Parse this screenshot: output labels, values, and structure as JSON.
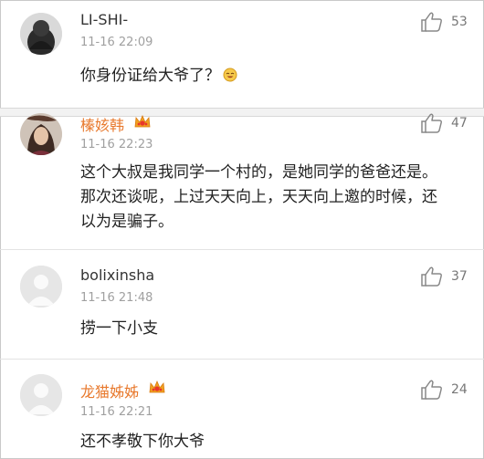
{
  "comments": [
    {
      "username": "LI-SHI-",
      "time": "11-16 22:09",
      "text": "你身份证给大爷了？",
      "emoji": "laughing-emoji",
      "likes": "53",
      "vip": false
    },
    {
      "username": "榛姟韩",
      "time": "11-16 22:23",
      "text": "这个大叔是我同学一个村的，是她同学的爸爸还是。那次还谈呢，上过天天向上，天天向上邀的时候，还以为是骗子。",
      "likes": "47",
      "vip": true
    },
    {
      "username": "bolixinsha",
      "time": "11-16 21:48",
      "text": "捞一下小支",
      "likes": "37",
      "vip": false
    },
    {
      "username": "龙猫姊姊",
      "time": "11-16 22:21",
      "text": "还不孝敬下你大爷",
      "likes": "24",
      "vip": true
    }
  ],
  "colors": {
    "vip_name": "#e8792d",
    "badge": "#f0a020",
    "time": "#a0a0a0"
  },
  "icons": {
    "like": "thumbs-up-icon",
    "badge": "vip-crown-icon",
    "avatar_default": "default-avatar-icon"
  }
}
